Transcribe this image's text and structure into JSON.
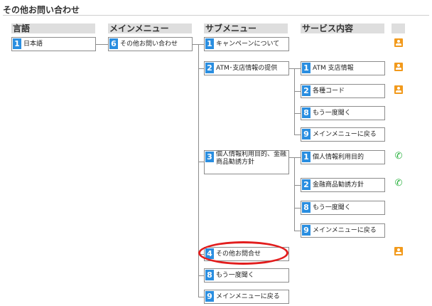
{
  "page_title": "その他お問い合わせ",
  "headers": {
    "language": "言語",
    "main_menu": "メインメニュー",
    "sub_menu": "サブメニュー",
    "service": "サービス内容"
  },
  "nodes": {
    "lang": {
      "num": "1",
      "label": "日本語"
    },
    "main": {
      "num": "6",
      "label": "その他お問い合わせ"
    },
    "sub1": {
      "num": "1",
      "label": "キャンペーンについて"
    },
    "sub2": {
      "num": "2",
      "label": "ATM･支店情報の提供"
    },
    "sub3": {
      "num": "3",
      "label": "個人情報利用目的、金融商品勧誘方針"
    },
    "sub4": {
      "num": "4",
      "label": "その他お問合せ"
    },
    "sub8": {
      "num": "8",
      "label": "もう一度聞く"
    },
    "sub9": {
      "num": "9",
      "label": "メインメニューに戻る"
    },
    "svc2_1": {
      "num": "1",
      "label": "ATM 支店情報"
    },
    "svc2_2": {
      "num": "2",
      "label": "各種コード"
    },
    "svc2_8": {
      "num": "8",
      "label": "もう一度聞く"
    },
    "svc2_9": {
      "num": "9",
      "label": "メインメニューに戻る"
    },
    "svc3_1": {
      "num": "1",
      "label": "個人情報利用目的"
    },
    "svc3_2": {
      "num": "2",
      "label": "金融商品勧誘方針"
    },
    "svc3_8": {
      "num": "8",
      "label": "もう一度聞く"
    },
    "svc3_9": {
      "num": "9",
      "label": "メインメニューに戻る"
    }
  },
  "icons": {
    "operator": "operator-icon",
    "phone": "phone-icon",
    "operator_color": "#f29a1c",
    "phone_color": "#2bb240",
    "number_badge_color": "#2a8ee0",
    "highlight_color": "#e21d1d"
  }
}
